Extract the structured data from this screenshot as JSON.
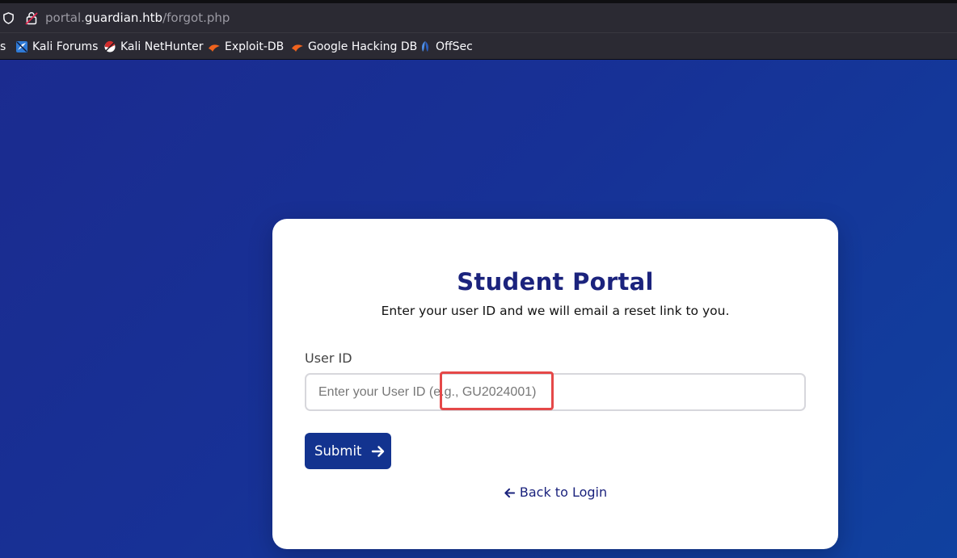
{
  "browser": {
    "url_prefix": "portal.",
    "url_domain": "guardian.htb",
    "url_path": "/forgot.php",
    "bookmarks": [
      {
        "label": "s",
        "icon": "none"
      },
      {
        "label": "Kali Forums",
        "icon": "kali-forums-icon"
      },
      {
        "label": "Kali NetHunter",
        "icon": "kali-nethunter-icon"
      },
      {
        "label": "Exploit-DB",
        "icon": "exploit-db-icon"
      },
      {
        "label": "Google Hacking DB",
        "icon": "ghdb-icon"
      },
      {
        "label": "OffSec",
        "icon": "offsec-icon"
      }
    ]
  },
  "card": {
    "title": "Student Portal",
    "subtitle": "Enter your user ID and we will email a reset link to you.",
    "field_label": "User ID",
    "input_value": "",
    "input_placeholder": "Enter your User ID (e.g., GU2024001)",
    "submit_label": "Submit",
    "back_label": "Back to Login"
  },
  "colors": {
    "accent": "#1b237d",
    "button": "#13338f",
    "highlight": "#e54848"
  }
}
